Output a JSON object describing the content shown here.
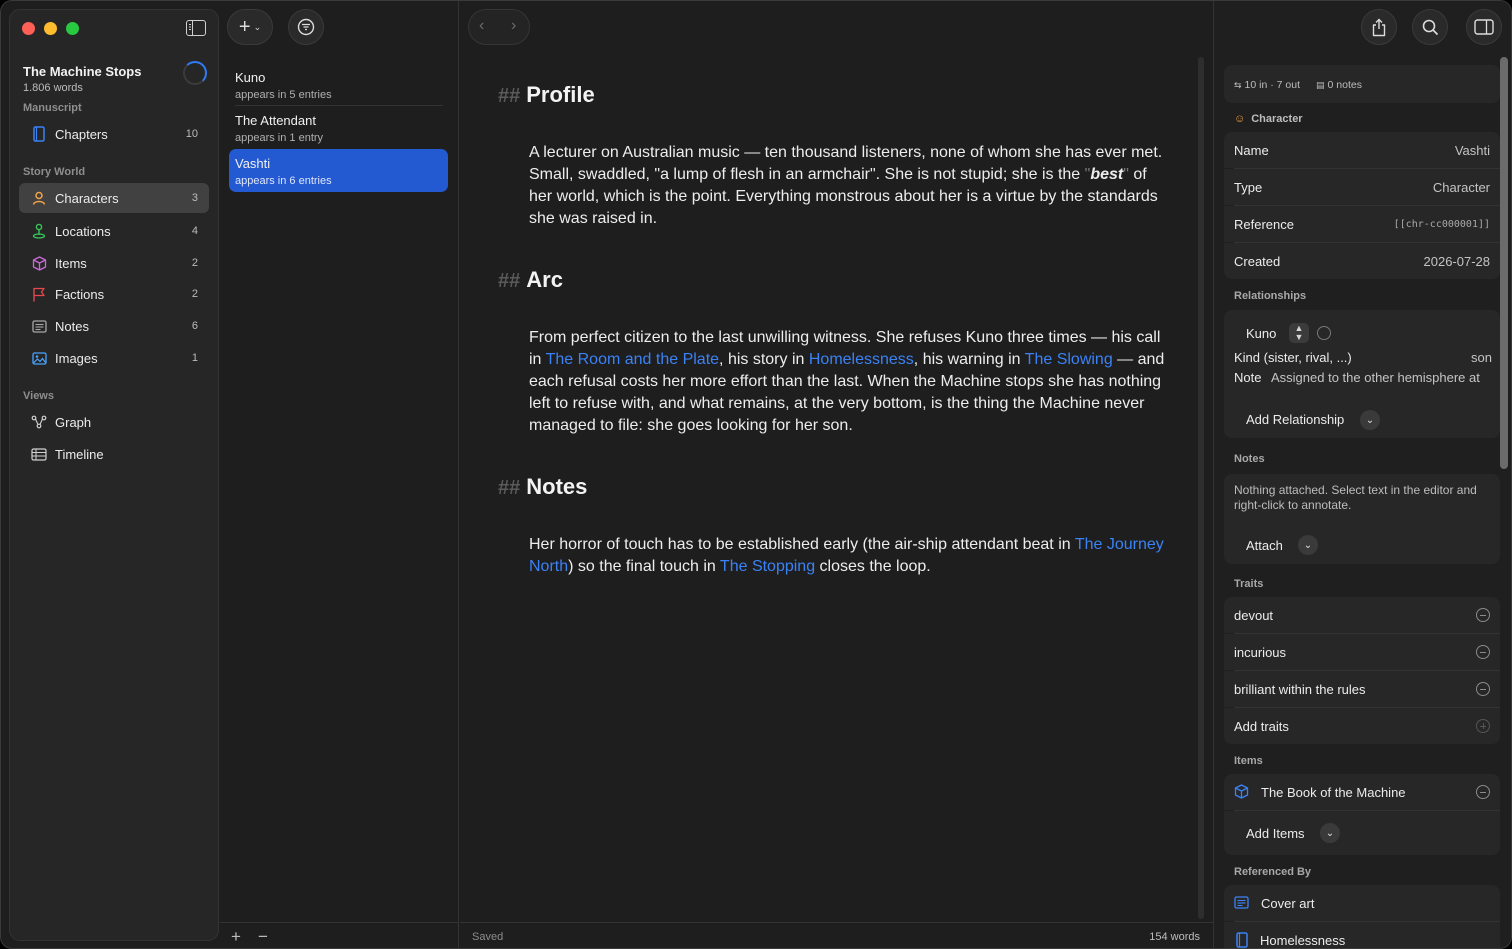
{
  "sidebar": {
    "project_title": "The Machine Stops",
    "word_count": "1.806 words",
    "sections": {
      "manuscript": "Manuscript",
      "story_world": "Story World",
      "views": "Views"
    },
    "items": [
      {
        "label": "Chapters",
        "count": "10",
        "icon": "book-icon"
      },
      {
        "label": "Characters",
        "count": "3",
        "icon": "person-icon"
      },
      {
        "label": "Locations",
        "count": "4",
        "icon": "map-pin-icon"
      },
      {
        "label": "Items",
        "count": "2",
        "icon": "cube-icon"
      },
      {
        "label": "Factions",
        "count": "2",
        "icon": "flag-icon"
      },
      {
        "label": "Notes",
        "count": "6",
        "icon": "note-icon"
      },
      {
        "label": "Images",
        "count": "1",
        "icon": "image-icon"
      },
      {
        "label": "Graph",
        "icon": "graph-icon"
      },
      {
        "label": "Timeline",
        "icon": "timeline-icon"
      }
    ]
  },
  "entries": [
    {
      "name": "Kuno",
      "sub": "appears in 5 entries"
    },
    {
      "name": "The Attendant",
      "sub": "appears in 1 entry"
    },
    {
      "name": "Vashti",
      "sub": "appears in 6 entries"
    }
  ],
  "editor": {
    "hash": "##",
    "sections": [
      {
        "heading": "Profile"
      },
      {
        "heading": "Arc"
      },
      {
        "heading": "Notes"
      }
    ],
    "profile_text": {
      "a": "A lecturer on Australian music — ten thousand listeners, none of whom she has ever met. Small, swaddled, \"a lump of flesh in an armchair\". She is not stupid; she is the ",
      "q1": "\"",
      "em": "best",
      "q2": "\"",
      "b": " of her world, which is the point. Everything monstrous about her is a virtue by the standards she was raised in."
    },
    "arc_text": {
      "a": "From perfect citizen to the last unwilling witness. She refuses Kuno three times — his call in ",
      "l1": "The Room and the Plate",
      "b": ", his story in ",
      "l2": "Homelessness",
      "c": ", his warning in ",
      "l3": "The Slowing",
      "d": " — and each refusal costs her more effort than the last. When the Machine stops she has nothing left to refuse with, and what remains, at the very bottom, is the thing the Machine never managed to file: she goes looking for her son."
    },
    "notes_text": {
      "a": "Her horror of touch has to be established early (the air-ship attendant beat in ",
      "l1": "The Journey North",
      "b": ") so the final touch in ",
      "l2": "The Stopping",
      "c": " closes the loop."
    },
    "footer_status": "Saved",
    "footer_words": "154 words"
  },
  "inspector": {
    "links_stat": "10 in · 7 out",
    "notes_stat": "0 notes",
    "type_header": "Character",
    "fields": [
      {
        "key": "Name",
        "value": "Vashti"
      },
      {
        "key": "Type",
        "value": "Character"
      },
      {
        "key": "Reference",
        "value": "[[chr-cc000001]]"
      },
      {
        "key": "Created",
        "value": "2026-07-28"
      }
    ],
    "relationships": {
      "header": "Relationships",
      "target": "Kuno",
      "kind_label": "Kind (sister, rival, ...)",
      "kind_value": "son",
      "note_label": "Note",
      "note_value": "Assigned to the other hemisphere at",
      "add_label": "Add Relationship"
    },
    "notes": {
      "header": "Notes",
      "empty_text": "Nothing attached. Select text in the editor and right-click to annotate.",
      "attach_label": "Attach"
    },
    "traits": {
      "header": "Traits",
      "items": [
        "devout",
        "incurious",
        "brilliant within the rules"
      ],
      "add_label": "Add traits"
    },
    "items": {
      "header": "Items",
      "list": [
        "The Book of the Machine"
      ],
      "add_label": "Add Items"
    },
    "referenced_by": {
      "header": "Referenced By",
      "list": [
        "Cover art",
        "Homelessness"
      ]
    }
  },
  "colors": {
    "accent": "#2359d1",
    "link": "#3b82f6",
    "character_orange": "#f0a24a"
  }
}
